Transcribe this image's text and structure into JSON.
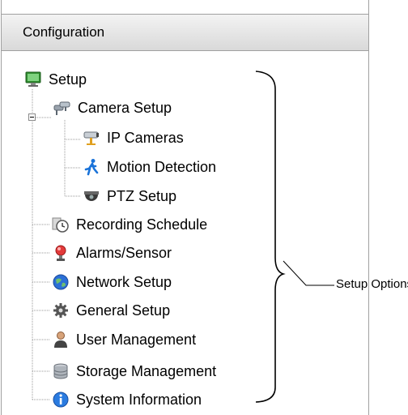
{
  "panel": {
    "title": "Configuration"
  },
  "tree": {
    "root": {
      "label": "Setup",
      "icon": "monitor-icon"
    },
    "camera_setup": {
      "label": "Camera Setup",
      "icon": "camera-group-icon"
    },
    "ip_cameras": {
      "label": "IP Cameras",
      "icon": "ip-camera-icon"
    },
    "motion_detection": {
      "label": "Motion Detection",
      "icon": "running-man-icon"
    },
    "ptz_setup": {
      "label": "PTZ Setup",
      "icon": "dome-camera-icon"
    },
    "recording_schedule": {
      "label": "Recording Schedule",
      "icon": "clock-icon"
    },
    "alarms_sensor": {
      "label": "Alarms/Sensor",
      "icon": "alarm-light-icon"
    },
    "network_setup": {
      "label": "Network Setup",
      "icon": "globe-icon"
    },
    "general_setup": {
      "label": "General Setup",
      "icon": "gear-icon"
    },
    "user_management": {
      "label": "User Management",
      "icon": "user-icon"
    },
    "storage_management": {
      "label": "Storage Management",
      "icon": "database-icon"
    },
    "system_information": {
      "label": "System Information",
      "icon": "info-icon"
    }
  },
  "callout": {
    "label": "Setup Options"
  }
}
